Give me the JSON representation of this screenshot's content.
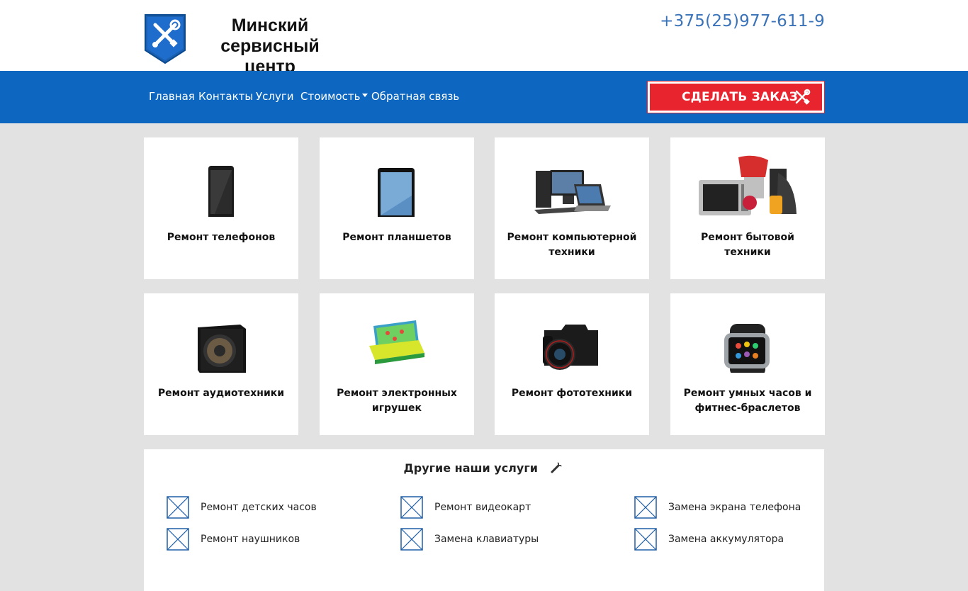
{
  "header": {
    "logo_line1": "Минский",
    "logo_line2": "сервисный центр",
    "phone": "+375(25)977-611-9"
  },
  "nav": {
    "items": [
      "Главная",
      "Контакты",
      "Услуги",
      "Стоимость",
      "Обратная связь"
    ],
    "order_button": "СДЕЛАТЬ ЗАКАЗ"
  },
  "cards": [
    {
      "title": "Ремонт телефонов",
      "icon": "phone-image"
    },
    {
      "title": "Ремонт планшетов",
      "icon": "tablet-image"
    },
    {
      "title": "Ремонт компьютерной техники",
      "icon": "computer-image"
    },
    {
      "title": "Ремонт бытовой техники",
      "icon": "appliances-image"
    },
    {
      "title": "Ремонт аудиотехники",
      "icon": "speaker-image"
    },
    {
      "title": "Ремонт электронных игрушек",
      "icon": "toy-laptop-image"
    },
    {
      "title": "Ремонт фототехники",
      "icon": "camera-image"
    },
    {
      "title": "Ремонт умных часов и фитнес-браслетов",
      "icon": "smartwatch-image"
    }
  ],
  "other_services": {
    "title": "Другие наши услуги",
    "items": [
      "Ремонт детских часов",
      "Ремонт видеокарт",
      "Замена экрана телефона",
      "Ремонт наушников",
      "Замена клавиатуры",
      "Замена аккумулятора"
    ]
  },
  "colors": {
    "nav_bg": "#0d67c1",
    "order_button": "#e8252f",
    "phone": "#3b73b9",
    "page_bg": "#e2e2e2"
  }
}
